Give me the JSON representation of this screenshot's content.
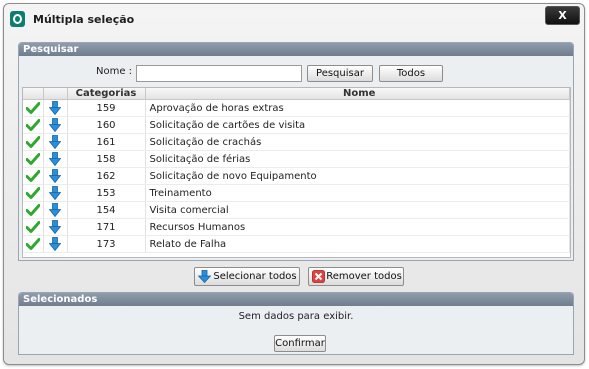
{
  "window": {
    "title": "Múltipla seleção",
    "close_label": "X"
  },
  "search": {
    "header": "Pesquisar",
    "name_label": "Nome :",
    "name_value": "",
    "search_button": "Pesquisar",
    "all_button": "Todos"
  },
  "table": {
    "columns": [
      "",
      "",
      "Categorias",
      "Nome"
    ],
    "rows": [
      {
        "id": "159",
        "name": "Aprovação de horas extras"
      },
      {
        "id": "160",
        "name": "Solicitação de cartões de visita"
      },
      {
        "id": "161",
        "name": "Solicitação de crachás"
      },
      {
        "id": "158",
        "name": "Solicitação de férias"
      },
      {
        "id": "162",
        "name": "Solicitação de novo Equipamento"
      },
      {
        "id": "153",
        "name": "Treinamento"
      },
      {
        "id": "154",
        "name": "Visita comercial"
      },
      {
        "id": "171",
        "name": "Recursos Humanos"
      },
      {
        "id": "173",
        "name": "Relato de Falha"
      }
    ]
  },
  "actions": {
    "select_all": "Selecionar todos",
    "remove_all": "Remover todos"
  },
  "selected": {
    "header": "Selecionados",
    "empty_text": "Sem dados para exibir.",
    "confirm_button": "Confirmar"
  },
  "icons": {
    "check": "check-icon",
    "down_arrow": "arrow-down-icon",
    "remove": "x-icon"
  },
  "colors": {
    "check_green": "#2fa82f",
    "arrow_blue": "#2a8fd8",
    "remove_red": "#d83a3a",
    "header_blue_gray": "#7f8c9c"
  }
}
